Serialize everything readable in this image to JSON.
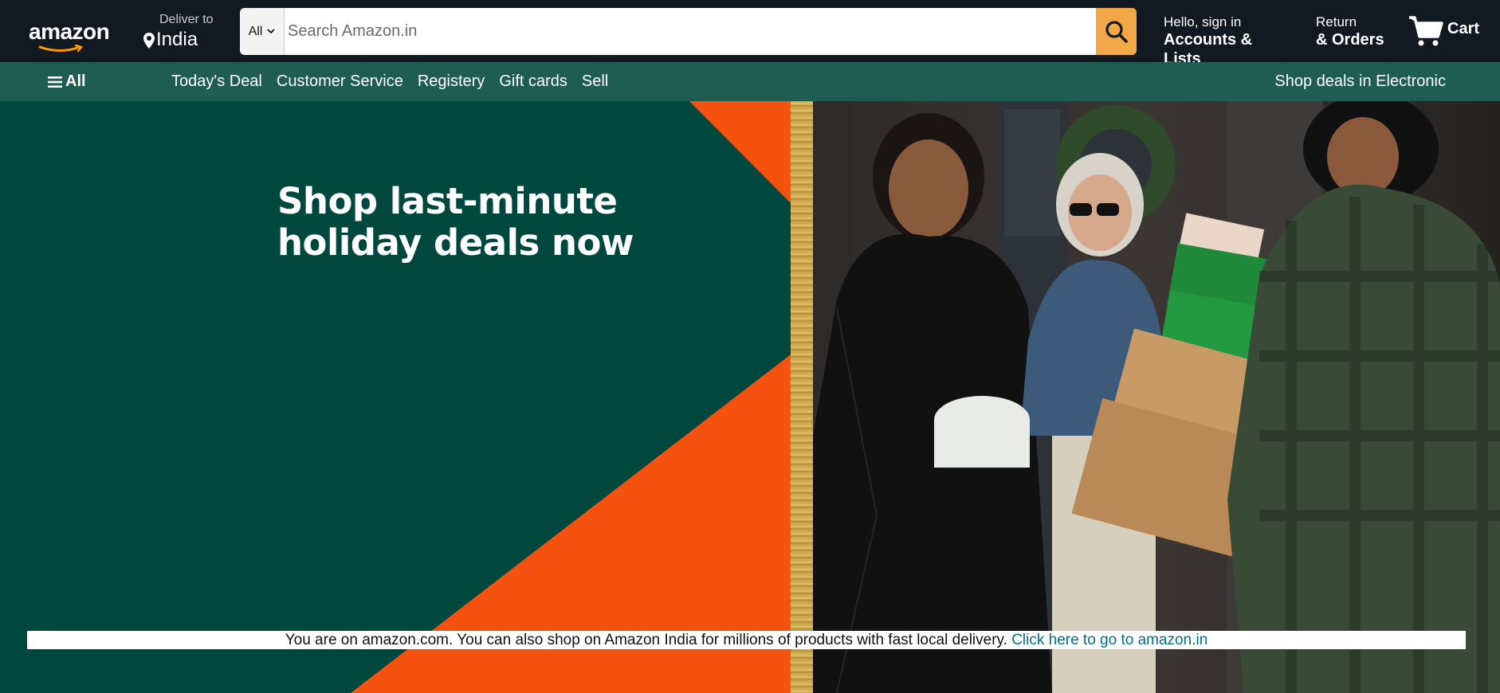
{
  "header": {
    "logo_text": "amazon",
    "deliver_label": "Deliver to",
    "deliver_location": "India",
    "search": {
      "category": "All",
      "placeholder": "Search Amazon.in"
    },
    "account": {
      "greeting": "Hello, sign in",
      "label": "Accounts & Lists"
    },
    "orders": {
      "line1": "Return",
      "line2": "& Orders"
    },
    "cart_label": "Cart"
  },
  "subnav": {
    "all_label": "All",
    "links": [
      "Today's Deal",
      "Customer Service",
      "Registery",
      "Gift cards",
      "Sell"
    ],
    "promo": "Shop deals in Electronic"
  },
  "hero": {
    "title": "Shop last-minute holiday deals now",
    "colors": {
      "dark_green": "#00473e",
      "orange": "#f4520e",
      "gold": "#d4b25a"
    }
  },
  "notice": {
    "text": "You are on amazon.com. You can also shop on Amazon India for millions of products with fast local delivery.",
    "link": "Click here to go to amazon.in"
  },
  "colors": {
    "nav_bg": "#131921",
    "subnav_bg": "#1f5c52",
    "search_button": "#f3a847",
    "link": "#007185"
  },
  "icons": {
    "logo_smile": "amazon-smile-icon",
    "location": "location-pin-icon",
    "search": "search-icon",
    "cart": "cart-icon",
    "menu": "hamburger-icon",
    "dropdown": "chevron-down-icon"
  }
}
